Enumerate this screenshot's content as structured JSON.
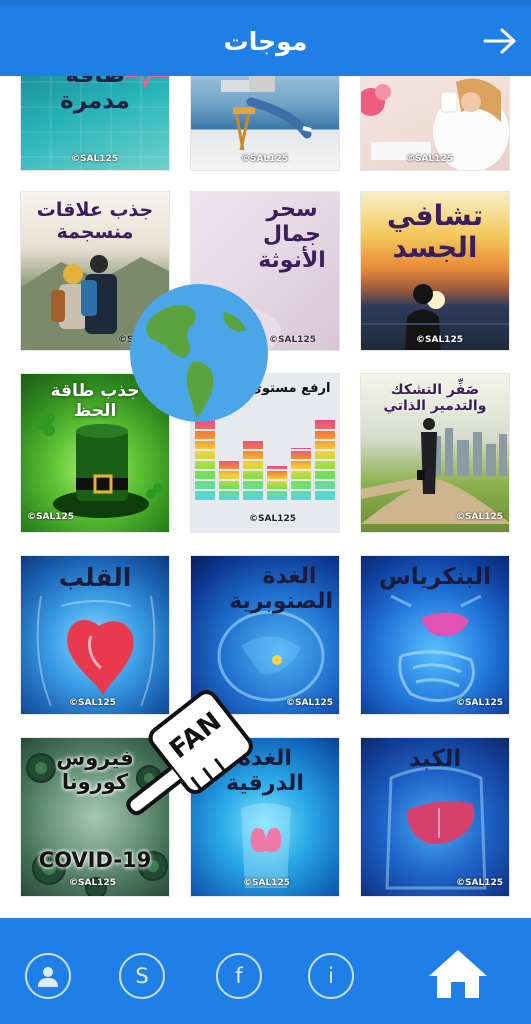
{
  "header": {
    "title": "موجات"
  },
  "tiles": [
    {
      "title": "طاقة\nمدمرة",
      "copyright": "©SAL125"
    },
    {
      "title": "",
      "copyright": "©SAL125"
    },
    {
      "title": "",
      "copyright": "©SAL125"
    },
    {
      "title": "جذب علاقات\nمنسجمة",
      "copyright": "©SAL125"
    },
    {
      "title": "سحر\nجمال\nالأنوثة",
      "copyright": "©SAL125"
    },
    {
      "title": "تشافي\nالجسد",
      "copyright": "©SAL125"
    },
    {
      "title": "جذب طاقة الحظ",
      "copyright": "©SAL125"
    },
    {
      "title": "ارفع مستوى ذبذباتك",
      "copyright": "©SAL125"
    },
    {
      "title": "صَفِّر التشكك\nوالتدمير الذاتي",
      "copyright": "©SAL125"
    },
    {
      "title": "القلب",
      "copyright": "©SAL125"
    },
    {
      "title": "الغدة\nالصنوبرية",
      "copyright": "©SAL125"
    },
    {
      "title": "البنكرياس",
      "copyright": "©SAL125"
    },
    {
      "title": "فيروس\nكورونا",
      "subtitle": "COVID-19",
      "copyright": "©SAL125"
    },
    {
      "title": "الغدة\nالدرقية",
      "copyright": "©SAL125"
    },
    {
      "title": "الكبد",
      "copyright": "©SAL125"
    }
  ],
  "overlay": {
    "fan_badge": "FAN"
  },
  "bottom_nav": {
    "profile": "profile-icon",
    "s_label": "S",
    "f_label": "f",
    "i_label": "i",
    "home": "home-icon"
  }
}
